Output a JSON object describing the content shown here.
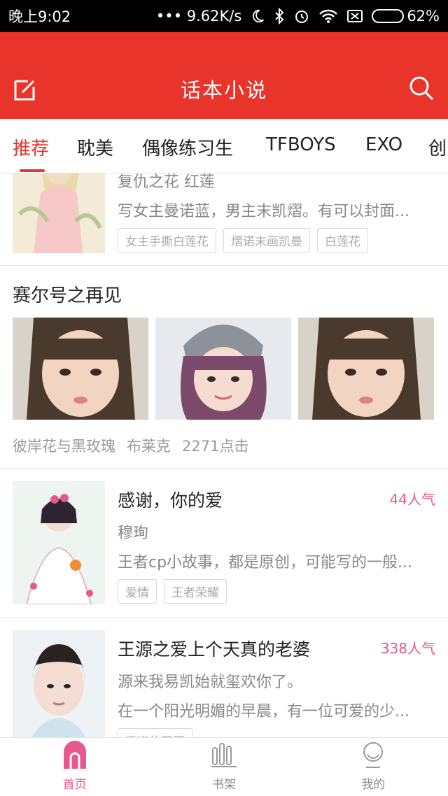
{
  "status_bar": {
    "time": "晚上9:02",
    "network_speed": "••• 9.62K/s",
    "battery": "62%"
  },
  "header": {
    "title": "话本小说"
  },
  "tabs": [
    {
      "label": "推荐",
      "active": true
    },
    {
      "label": "耽美",
      "active": false
    },
    {
      "label": "偶像练习生",
      "active": false
    },
    {
      "label": "TFBOYS",
      "active": false
    },
    {
      "label": "EXO",
      "active": false
    },
    {
      "label": "创",
      "active": false
    }
  ],
  "books_top": {
    "subtitle": "复仇之花 红莲",
    "desc": "写女主曼诺蓝，男主末凯熠。有可以封面...",
    "tags": [
      "女主手撕白莲花",
      "熠诺末画凯曼",
      "白莲花"
    ]
  },
  "gallery": {
    "title": "赛尔号之再见",
    "meta": [
      "彼岸花与黑玫瑰",
      "布莱克",
      "2271点击"
    ]
  },
  "books": [
    {
      "title": "感谢，你的爱",
      "popularity": "44人气",
      "author": "穆珣",
      "desc": "王者cp小故事，都是原创，可能写的一般...",
      "tags": [
        "爱情",
        "王者荣耀"
      ]
    },
    {
      "title": "王源之爱上个天真的老婆",
      "popularity": "338人气",
      "author": "源来我易凯始就玺欢你了。",
      "desc": "在一个阳光明媚的早晨，有一位可爱的少...",
      "tags": [
        "霸道的王源"
      ]
    }
  ],
  "bottom_nav": [
    {
      "label": "首页",
      "icon": "home-icon",
      "active": true
    },
    {
      "label": "书架",
      "icon": "bookshelf-icon",
      "active": false
    },
    {
      "label": "我的",
      "icon": "profile-icon",
      "active": false
    }
  ],
  "colors": {
    "brand_red": "#e8342a",
    "pink_accent": "#e8578e"
  }
}
